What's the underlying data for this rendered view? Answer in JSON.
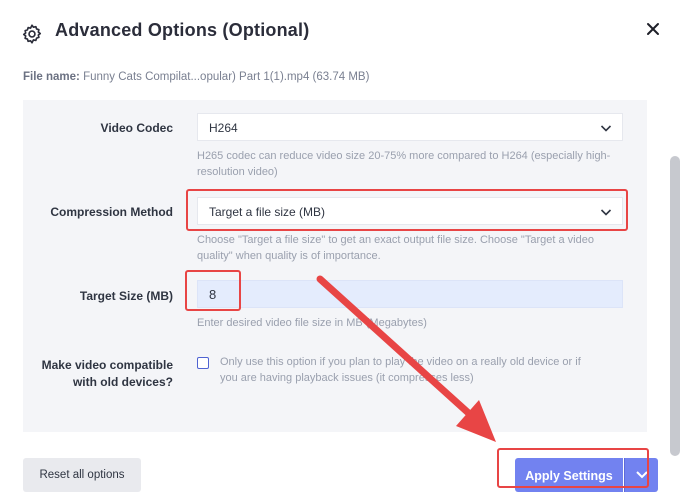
{
  "dialog": {
    "title": "Advanced Options (Optional)",
    "file_label": "File name:",
    "file_value": "Funny Cats Compilat...opular) Part 1(1).mp4 (63.74 MB)"
  },
  "fields": {
    "video_codec": {
      "label": "Video Codec",
      "value": "H264",
      "help_line1": "H265 codec can reduce video size 20-75% more compared to H264 (especially high-",
      "help_line2": "resolution video)"
    },
    "compression_method": {
      "label": "Compression Method",
      "value": "Target a file size (MB)",
      "help_line1": "Choose \"Target a file size\" to get an exact output file size. Choose \"Target a video",
      "help_line2": "quality\" when quality is of importance."
    },
    "target_size": {
      "label": "Target Size (MB)",
      "value": "8",
      "help": "Enter desired video file size in MB (Megabytes)"
    },
    "old_devices": {
      "label_line1": "Make video compatible",
      "label_line2": "with old devices?",
      "help_line1": "Only use this option if you plan to play the video on a really old device or if",
      "help_line2": "you are having playback issues (it compresses less)",
      "checked": false
    }
  },
  "buttons": {
    "reset": "Reset all options",
    "apply": "Apply Settings"
  },
  "icons": {
    "settings": "gear-icon",
    "close": "close-icon",
    "dropdown": "chevron-down-icon"
  },
  "colors": {
    "accent": "#7282f0",
    "highlight_red": "#e84545",
    "input_active_bg": "#e4ecfd"
  }
}
